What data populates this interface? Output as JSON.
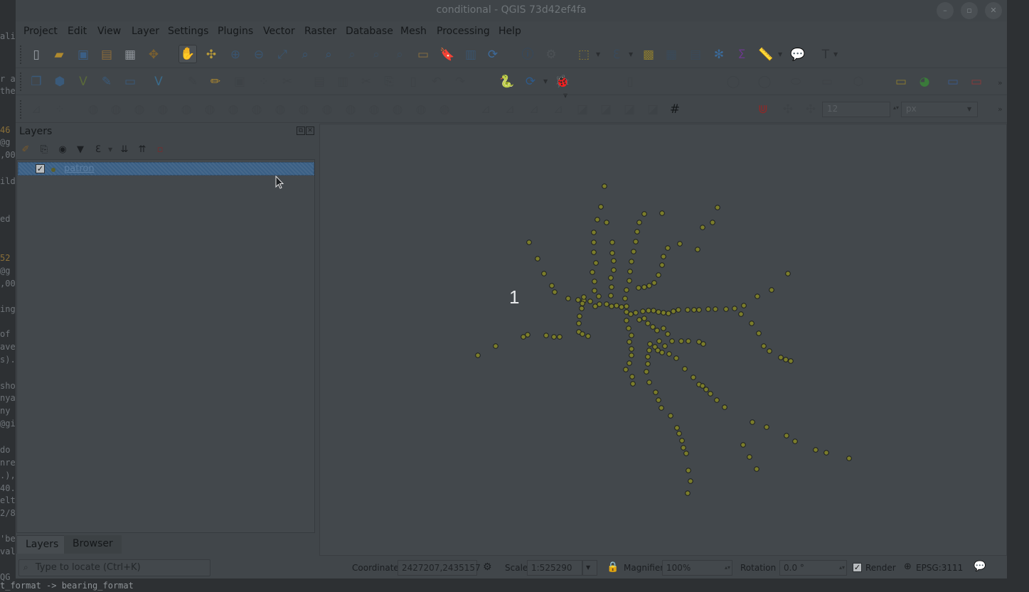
{
  "window": {
    "title": "conditional - QGIS 73d42ef4fa",
    "controls": [
      "–",
      "▫",
      "✕"
    ]
  },
  "menu": [
    "Project",
    "Edit",
    "View",
    "Layer",
    "Settings",
    "Plugins",
    "Vector",
    "Raster",
    "Database",
    "Mesh",
    "Processing",
    "Help"
  ],
  "terminal": {
    "bottom_line": "t_format -> bearing_format"
  },
  "toolbar": {
    "snapping_tolerance": "12",
    "snapping_unit": "px"
  },
  "layers_panel": {
    "title": "Layers",
    "layer": {
      "name": "patron",
      "checked": true
    }
  },
  "panel_tabs": [
    "Layers",
    "Browser"
  ],
  "map": {
    "label": "1",
    "point_color": "#7b7d2b"
  },
  "statusbar": {
    "locator_placeholder": "Type to locate (Ctrl+K)",
    "coordinate_label": "Coordinate",
    "coordinate_value": "2427207,2435157",
    "scale_label": "Scale",
    "scale_value": "1:525290",
    "magnifier_label": "Magnifier",
    "magnifier_value": "100%",
    "rotation_label": "Rotation",
    "rotation_value": "0.0 °",
    "render_label": "Render",
    "render_checked": true,
    "crs": "EPSG:3111"
  }
}
